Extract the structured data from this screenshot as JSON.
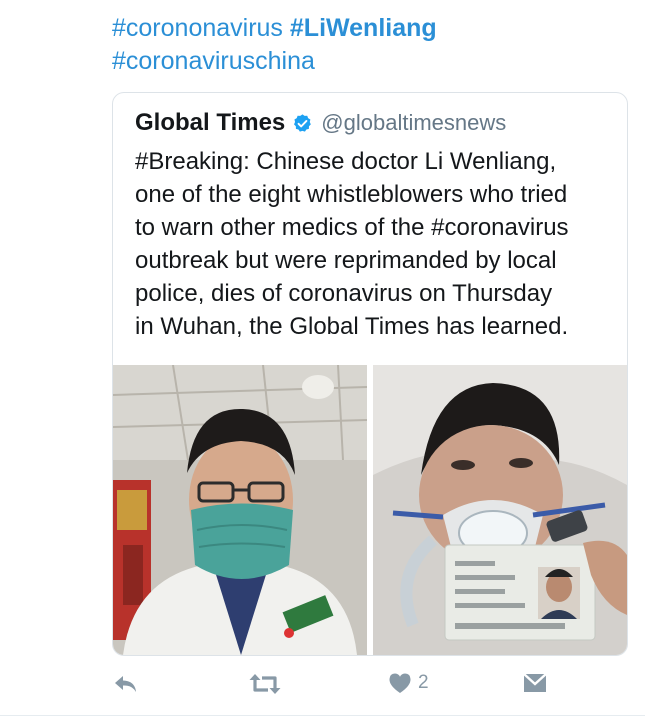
{
  "tweet": {
    "hashtags": [
      "#corononavirus",
      "#LiWenliang",
      "#coronaviruschina"
    ]
  },
  "quoted_tweet": {
    "name": "Global Times",
    "handle": "@globaltimesnews",
    "text_lines": [
      "#Breaking: Chinese doctor Li Wenliang,",
      "one of the eight whistleblowers who tried",
      "to warn other medics of the #coronavirus",
      "outbreak but were reprimanded by local",
      "police, dies of coronavirus on Thursday",
      "in Wuhan, the Global Times has learned."
    ],
    "photos": [
      "doctor-with-mask-photo",
      "doctor-in-hospital-bed-photo"
    ]
  },
  "actions": {
    "like_count": "2"
  },
  "colors": {
    "link": "#2b8fd6",
    "verified": "#1da1f2",
    "icon": "#8899a6"
  },
  "icons": [
    "reply-icon",
    "retweet-icon",
    "like-icon",
    "direct-message-icon",
    "verified-badge-icon"
  ]
}
